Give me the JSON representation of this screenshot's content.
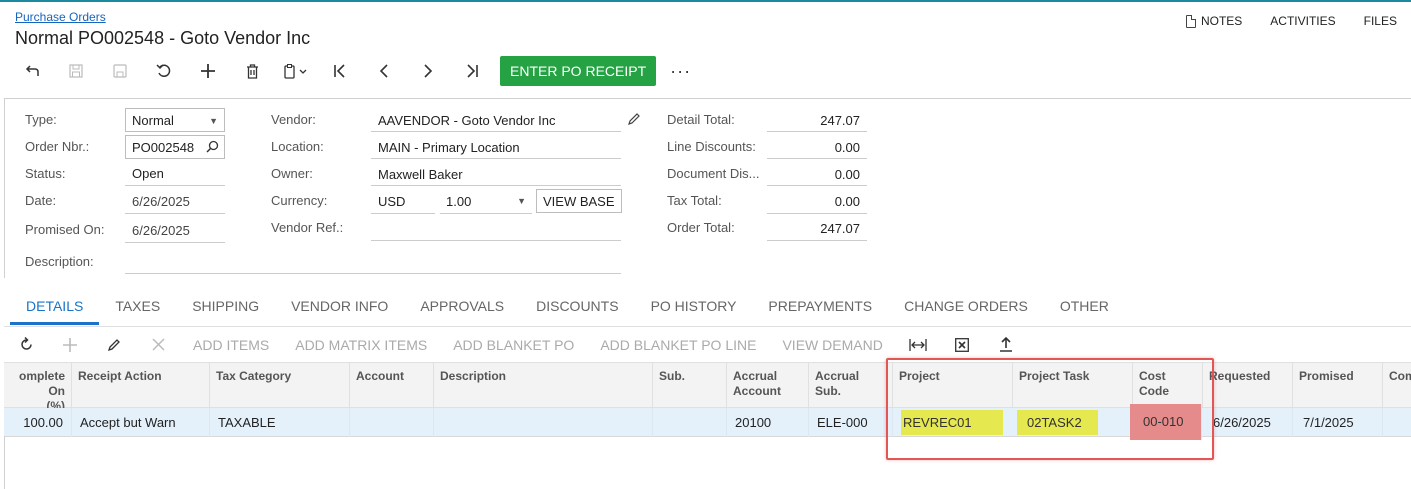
{
  "header": {
    "breadcrumb": "Purchase Orders",
    "title": "Normal PO002548 - Goto Vendor Inc",
    "links": {
      "notes": "NOTES",
      "activities": "ACTIVITIES",
      "files": "FILES"
    }
  },
  "toolbar": {
    "enter_receipt_label": "ENTER PO RECEIPT",
    "more_label": "···",
    "icons": [
      "undo-back",
      "save-close",
      "save",
      "cancel",
      "add",
      "delete",
      "copy-paste",
      "first",
      "previous",
      "next",
      "last"
    ]
  },
  "form": {
    "type_label": "Type:",
    "type_value": "Normal",
    "order_label": "Order Nbr.:",
    "order_value": "PO002548",
    "status_label": "Status:",
    "status_value": "Open",
    "date_label": "Date:",
    "date_value": "6/26/2025",
    "promised_label": "Promised On:",
    "promised_value": "6/26/2025",
    "description_label": "Description:",
    "vendor_label": "Vendor:",
    "vendor_value": "AAVENDOR - Goto Vendor Inc",
    "location_label": "Location:",
    "location_value": "MAIN - Primary Location",
    "owner_label": "Owner:",
    "owner_value": "Maxwell Baker",
    "currency_label": "Currency:",
    "currency_value": "USD",
    "rate_value": "1.00",
    "view_base_label": "VIEW BASE",
    "vendor_ref_label": "Vendor Ref.:",
    "detail_total_label": "Detail Total:",
    "detail_total_value": "247.07",
    "line_discounts_label": "Line Discounts:",
    "line_discounts_value": "0.00",
    "document_dis_label": "Document Dis...",
    "document_dis_value": "0.00",
    "tax_total_label": "Tax Total:",
    "tax_total_value": "0.00",
    "order_total_label": "Order Total:",
    "order_total_value": "247.07"
  },
  "tabs": [
    "DETAILS",
    "TAXES",
    "SHIPPING",
    "VENDOR INFO",
    "APPROVALS",
    "DISCOUNTS",
    "PO HISTORY",
    "PREPAYMENTS",
    "CHANGE ORDERS",
    "OTHER"
  ],
  "grid_toolbar": {
    "add_items": "ADD ITEMS",
    "add_matrix_items": "ADD MATRIX ITEMS",
    "add_blanket_po": "ADD BLANKET PO",
    "add_blanket_po_line": "ADD BLANKET PO LINE",
    "view_demand": "VIEW DEMAND"
  },
  "grid": {
    "columns": [
      {
        "h1": "omplete On",
        "h2": "(%)"
      },
      {
        "h1": "Receipt Action",
        "h2": ""
      },
      {
        "h1": "Tax Category",
        "h2": ""
      },
      {
        "h1": "Account",
        "h2": ""
      },
      {
        "h1": "Description",
        "h2": ""
      },
      {
        "h1": "Sub.",
        "h2": ""
      },
      {
        "h1": "Accrual",
        "h2": "Account"
      },
      {
        "h1": "Accrual",
        "h2": "Sub."
      },
      {
        "h1": "Project",
        "h2": ""
      },
      {
        "h1": "Project Task",
        "h2": ""
      },
      {
        "h1": "Cost",
        "h2": "Code"
      },
      {
        "h1": "Requested",
        "h2": ""
      },
      {
        "h1": "Promised",
        "h2": ""
      },
      {
        "h1": "Com",
        "h2": ""
      }
    ],
    "row": [
      "100.00",
      "Accept but Warn",
      "TAXABLE",
      "",
      "",
      "",
      "20100",
      "ELE-000",
      "REVREC01",
      "02TASK2",
      "00-010",
      "6/26/2025",
      "7/1/2025",
      ""
    ]
  },
  "colors": {
    "accent": "#1a73c8",
    "primary_button": "#25a243",
    "highlight_yellow": "#e5e84e",
    "highlight_red": "#e58b8b",
    "frame": "#e25656"
  }
}
